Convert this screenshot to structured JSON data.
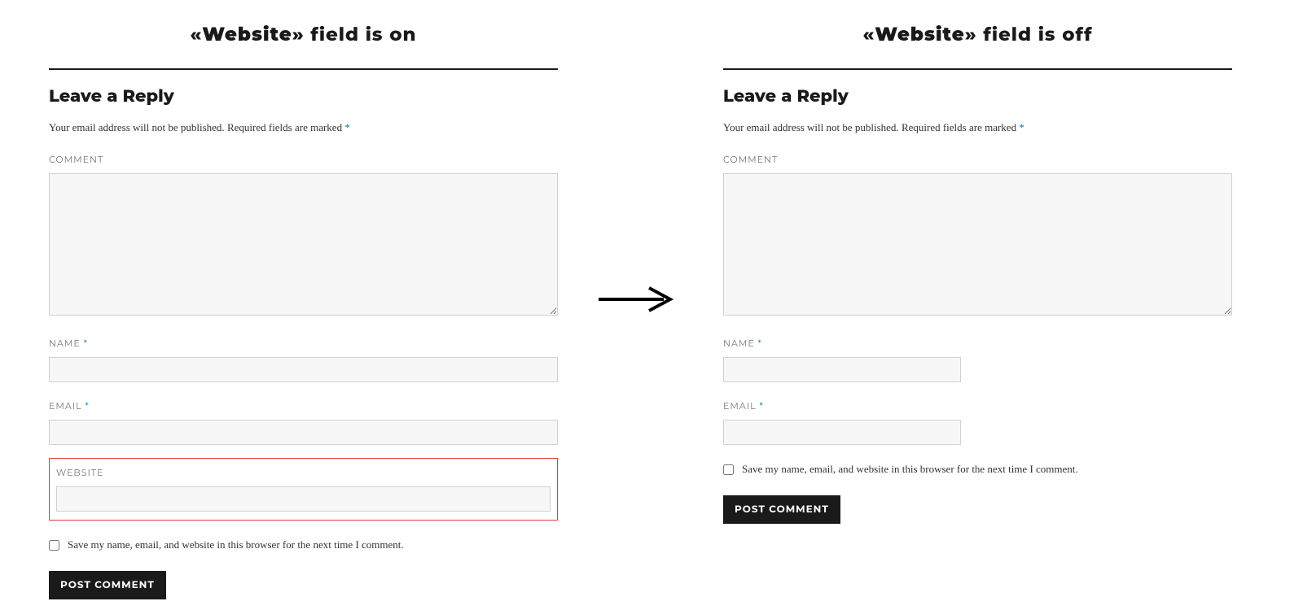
{
  "left": {
    "title_prefix": "«",
    "title_word": "Website",
    "title_suffix": "» field is on",
    "heading": "Leave a Reply",
    "notice_a": "Your email address will not be published.",
    "notice_b": "Required fields are marked",
    "required_mark": "*",
    "labels": {
      "comment": "COMMENT",
      "name": "NAME",
      "email": "EMAIL",
      "website": "WEBSITE"
    },
    "consent_text": "Save my name, email, and website in this browser for the next time I comment.",
    "submit_label": "POST COMMENT"
  },
  "right": {
    "title_prefix": "«",
    "title_word": "Website",
    "title_suffix": "» field is off",
    "heading": "Leave a Reply",
    "notice_a": "Your email address will not be published.",
    "notice_b": "Required fields are marked",
    "required_mark": "*",
    "labels": {
      "comment": "COMMENT",
      "name": "NAME",
      "email": "EMAIL"
    },
    "consent_text": "Save my name, email, and website in this browser for the next time I comment.",
    "submit_label": "POST COMMENT"
  },
  "colors": {
    "accent": "#007acc",
    "highlight_border": "#e53935",
    "button_bg": "#1a1a1a"
  }
}
